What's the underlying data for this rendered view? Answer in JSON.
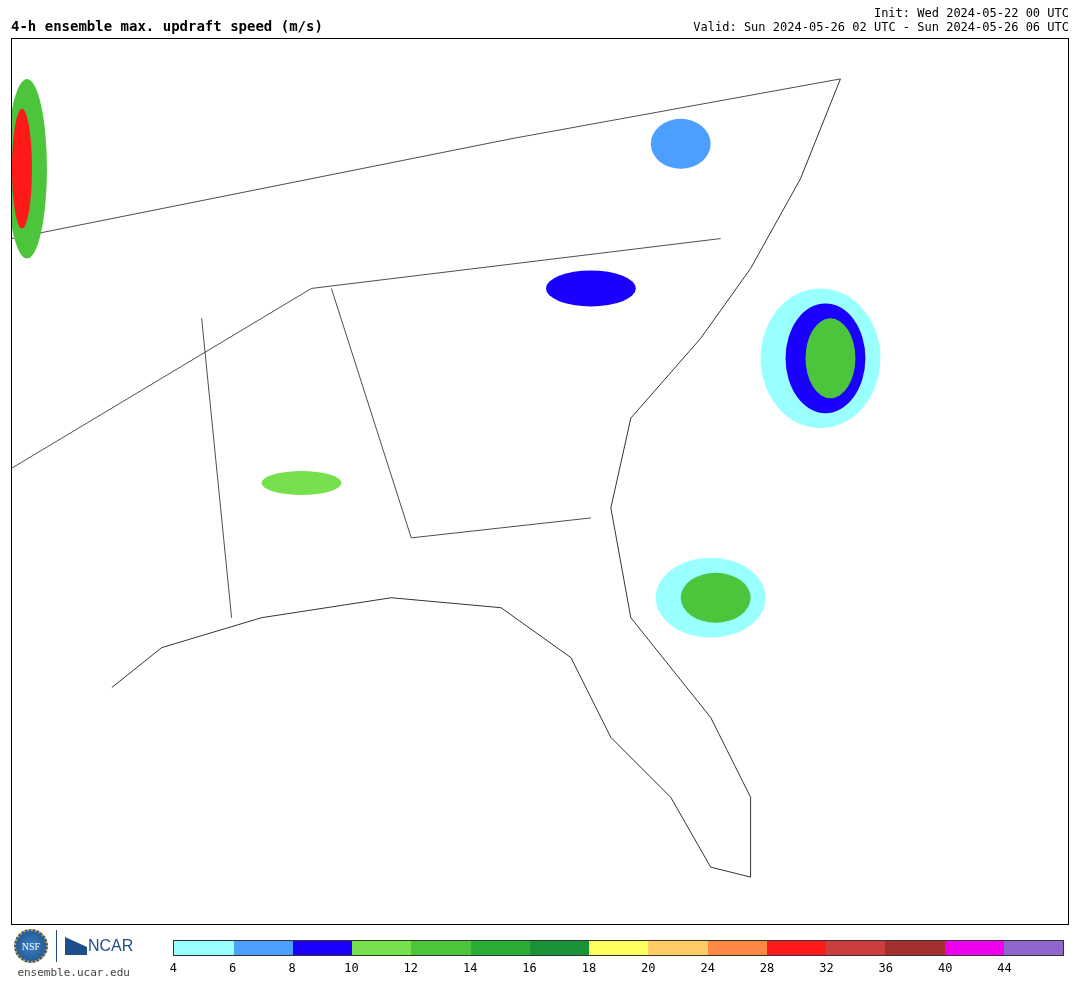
{
  "title": "4-h ensemble max. updraft speed (m/s)",
  "init": "Init: Wed 2024-05-22 00 UTC",
  "valid": "Valid: Sun 2024-05-26 02 UTC - Sun 2024-05-26 06 UTC",
  "logos": {
    "nsf": "NSF",
    "ncar": "NCAR",
    "url": "ensemble.ucar.edu"
  },
  "legend": [
    {
      "label": "4",
      "color": "#99ffff"
    },
    {
      "label": "6",
      "color": "#4d9fff"
    },
    {
      "label": "8",
      "color": "#1a00ff"
    },
    {
      "label": "10",
      "color": "#77e04d"
    },
    {
      "label": "12",
      "color": "#4cc43c"
    },
    {
      "label": "14",
      "color": "#2aad34"
    },
    {
      "label": "16",
      "color": "#1a9338"
    },
    {
      "label": "18",
      "color": "#ffff60"
    },
    {
      "label": "20",
      "color": "#ffcc66"
    },
    {
      "label": "24",
      "color": "#ff8844"
    },
    {
      "label": "28",
      "color": "#ff1a1a"
    },
    {
      "label": "32",
      "color": "#cc3d3d"
    },
    {
      "label": "36",
      "color": "#a33030"
    },
    {
      "label": "40",
      "color": "#ee00ee"
    },
    {
      "label": "44",
      "color": "#8f66cc"
    }
  ]
}
